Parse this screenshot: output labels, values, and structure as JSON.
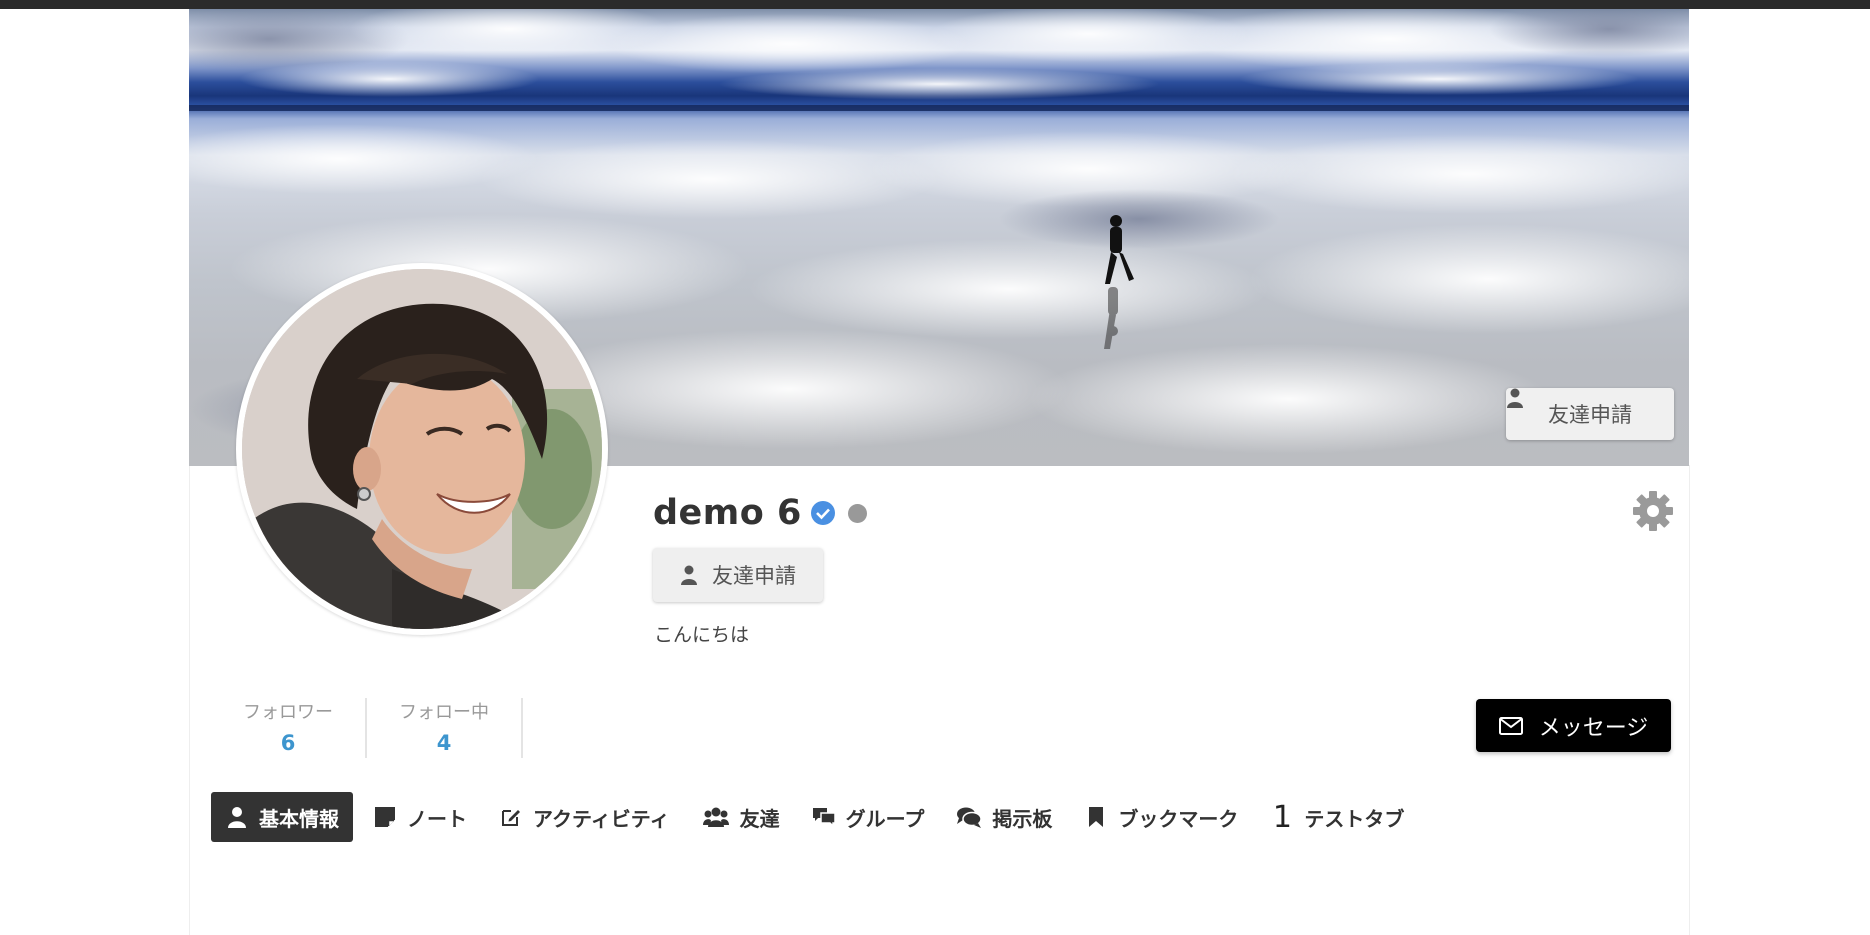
{
  "cover": {
    "friend_request_label": "友達申請"
  },
  "profile": {
    "name": "demo 6",
    "friend_request_label": "友達申請",
    "bio": "こんにちは"
  },
  "stats": [
    {
      "label": "フォロワー",
      "value": "6"
    },
    {
      "label": "フォロー中",
      "value": "4"
    }
  ],
  "message_button": {
    "label": "メッセージ"
  },
  "tabs": [
    {
      "label": "基本情報",
      "icon": "user-icon",
      "active": true
    },
    {
      "label": "ノート",
      "icon": "note-icon"
    },
    {
      "label": "アクティビティ",
      "icon": "edit-icon"
    },
    {
      "label": "友達",
      "icon": "users-icon"
    },
    {
      "label": "グループ",
      "icon": "chat-group-icon"
    },
    {
      "label": "掲示板",
      "icon": "comments-icon"
    },
    {
      "label": "ブックマーク",
      "icon": "bookmark-icon"
    },
    {
      "label": "テストタブ",
      "icon": "number-1",
      "badge": "1"
    }
  ],
  "colors": {
    "accent_blue": "#3d95ce",
    "verified_blue": "#4a90e2",
    "active_tab_bg": "#333333",
    "message_button_bg": "#000000"
  }
}
